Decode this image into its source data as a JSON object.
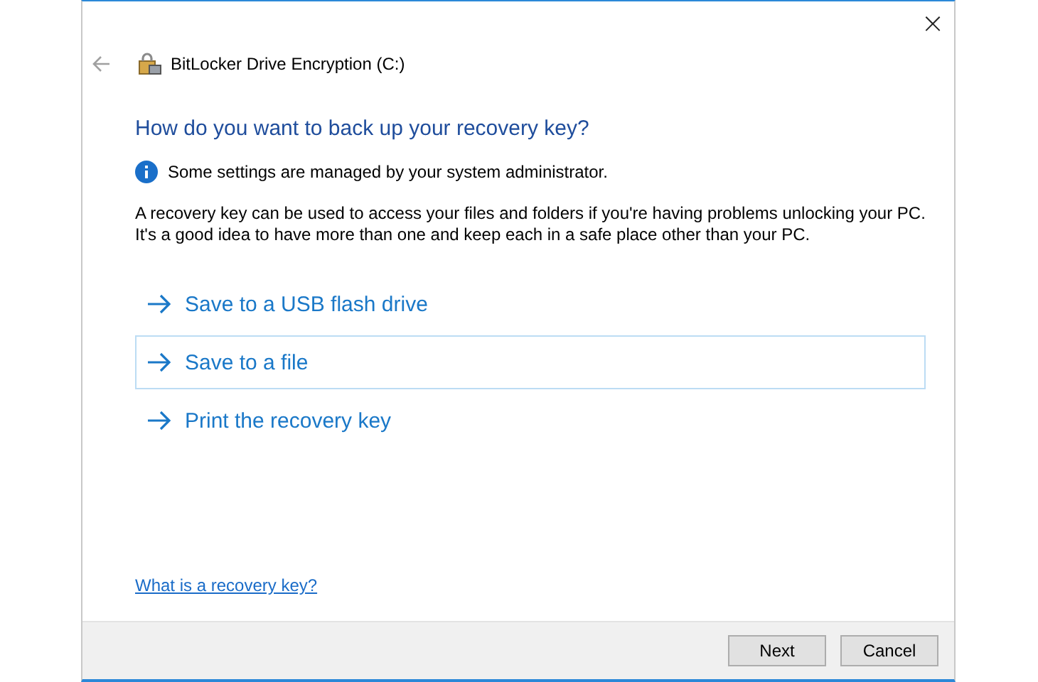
{
  "window": {
    "title": "BitLocker Drive Encryption (C:)",
    "close": "×"
  },
  "heading": "How do you want to back up your recovery key?",
  "notice": "Some settings are managed by your system administrator.",
  "description": "A recovery key can be used to access your files and folders if you're having problems unlocking your PC. It's a good idea to have more than one and keep each in a safe place other than your PC.",
  "options": [
    {
      "label": "Save to a USB flash drive",
      "selected": false
    },
    {
      "label": "Save to a file",
      "selected": true
    },
    {
      "label": "Print the recovery key",
      "selected": false
    }
  ],
  "help_link": "What is a recovery key?",
  "buttons": [
    {
      "label": "Next"
    },
    {
      "label": "Cancel"
    }
  ]
}
